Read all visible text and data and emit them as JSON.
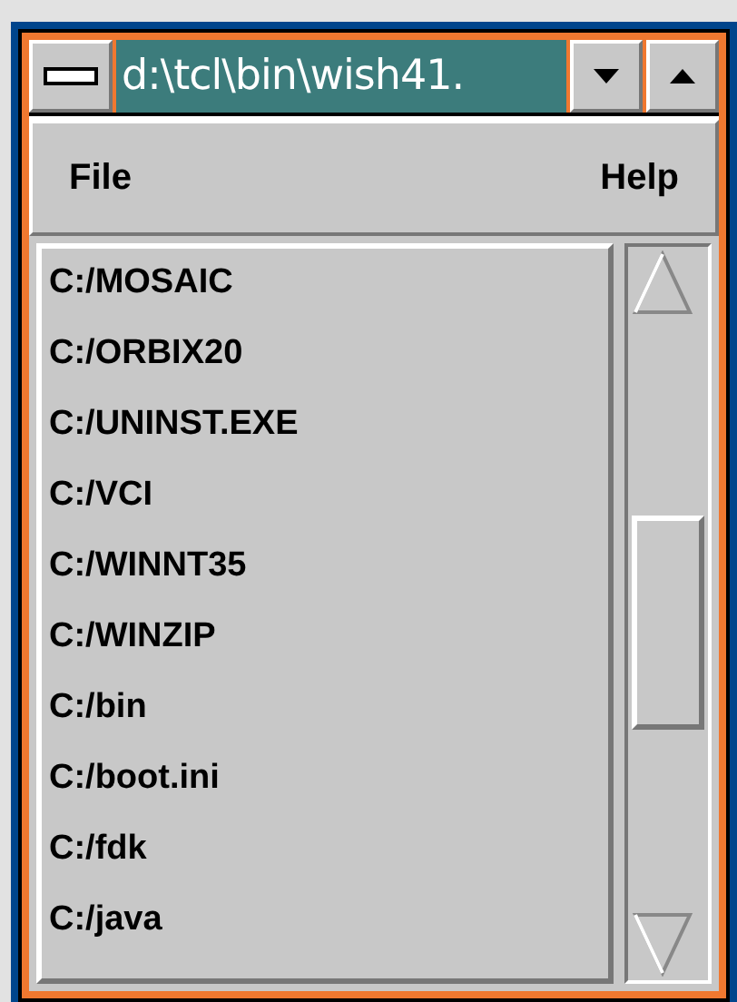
{
  "window": {
    "title": "d:\\tcl\\bin\\wish41."
  },
  "menu": [
    {
      "label": "File"
    },
    {
      "label": "Help"
    }
  ],
  "list": [
    "C:/MOSAIC",
    "C:/ORBIX20",
    "C:/UNINST.EXE",
    "C:/VCI",
    "C:/WINNT35",
    "C:/WINZIP",
    "C:/bin",
    "C:/boot.ini",
    "C:/fdk",
    "C:/java"
  ]
}
